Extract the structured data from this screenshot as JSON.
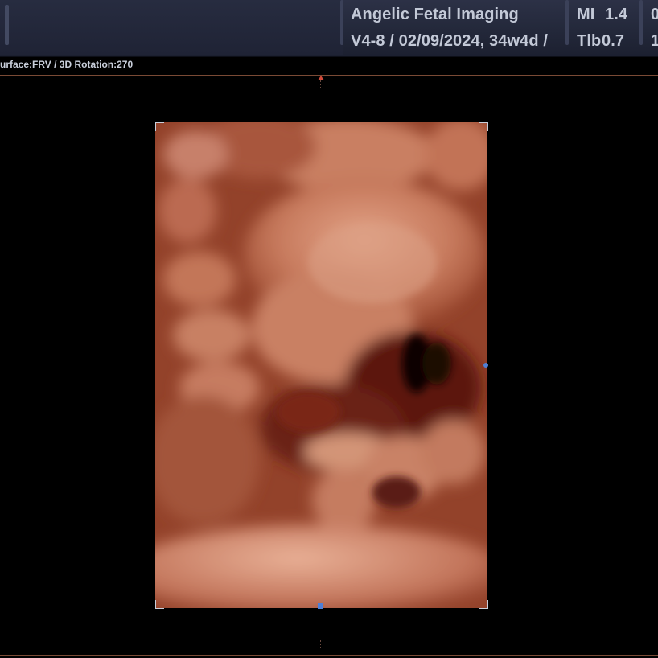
{
  "header": {
    "clinic_name": "Angelic Fetal Imaging",
    "exam_info": "V4-8 / 02/09/2024, 34w4d /",
    "mi_label": "MI",
    "mi_value": "1.4",
    "tib_label": "Tlb",
    "tib_value": "0.7",
    "truncated_top": "0",
    "truncated_bottom": "1"
  },
  "viewport": {
    "render_mode": "urface:FRV / 3D Rotation:270"
  },
  "colors": {
    "header_bg": "#23283a",
    "text": "#c3c9d7",
    "volume_base": "#8f3d25",
    "skin_highlight": "#e6a58a",
    "handle": "#4f7fd6",
    "rule": "#7a4a35"
  },
  "icons": [
    "orientation-arrow-icon",
    "crop-corner-icon",
    "rotation-handle-icon"
  ]
}
